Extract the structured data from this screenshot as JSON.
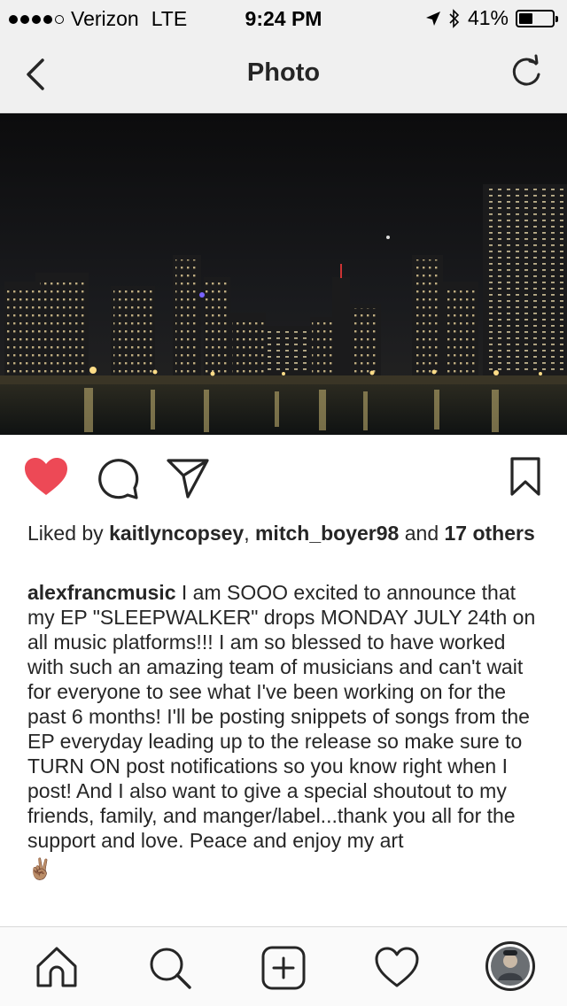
{
  "status_bar": {
    "carrier": "Verizon",
    "network": "LTE",
    "time": "9:24 PM",
    "battery": "41%",
    "battery_level": 0.41,
    "signal_bars_filled": 4,
    "signal_bars_total": 5
  },
  "nav": {
    "title": "Photo",
    "back_icon": "chevron-left-icon",
    "refresh_icon": "refresh-icon"
  },
  "photo": {
    "icon": "city-skyline-night-photo"
  },
  "actions": {
    "like_icon": "heart-filled-icon",
    "like_color": "#ed4956",
    "comment_icon": "comment-icon",
    "share_icon": "send-icon",
    "save_icon": "bookmark-icon"
  },
  "likes": {
    "prefix": "Liked by ",
    "user1": "kaitlyncopsey",
    "sep": ", ",
    "user2": "mitch_boyer98",
    "and": " and ",
    "others": "17 others"
  },
  "caption": {
    "username": "alexfrancmusic",
    "text": " I am SOOO excited to announce that my EP \"SLEEPWALKER\" drops MONDAY JULY 24th on all music platforms!!! I am so blessed to have worked with such an amazing team of musicians and can't wait for everyone to see what I've been working on for the past 6 months! I'll be posting snippets of songs from the EP everyday leading up to the release so make sure to TURN ON post notifications so you know right when I post! And I also want to give a special shoutout to my friends, family, and manger/label...thank you all for the support and love. Peace and enjoy my art",
    "emoji": "✌🏽"
  },
  "tab_bar": {
    "items": [
      "home-icon",
      "search-icon",
      "add-post-icon",
      "activity-heart-icon",
      "profile-avatar"
    ]
  }
}
